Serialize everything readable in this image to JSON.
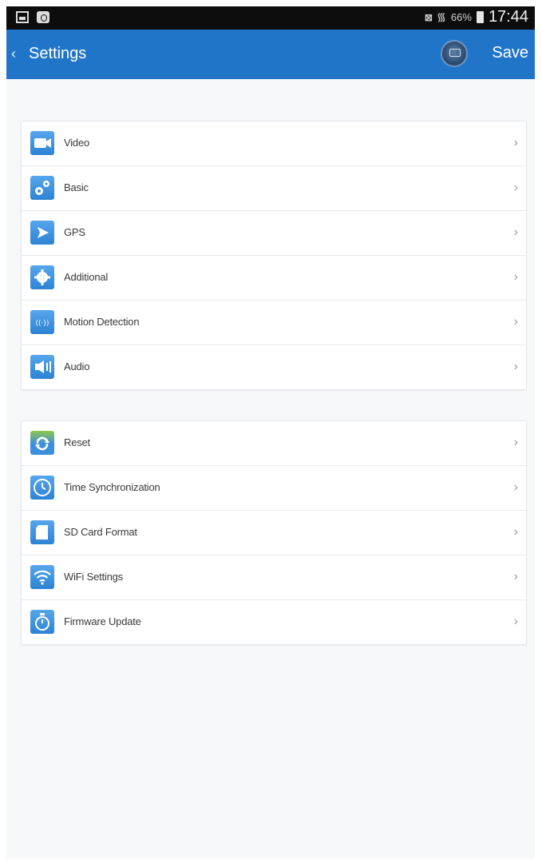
{
  "status_bar": {
    "battery_pct": "66%",
    "time": "17:44"
  },
  "app_bar": {
    "title": "Settings",
    "save_label": "Save"
  },
  "groups": [
    {
      "items": [
        {
          "label": "Video",
          "icon": "video-camera-icon"
        },
        {
          "label": "Basic",
          "icon": "gears-icon"
        },
        {
          "label": "GPS",
          "icon": "gps-icon"
        },
        {
          "label": "Additional",
          "icon": "gear-icon"
        },
        {
          "label": "Motion Detection",
          "icon": "motion-detection-icon"
        },
        {
          "label": "Audio",
          "icon": "speaker-icon"
        }
      ]
    },
    {
      "items": [
        {
          "label": "Reset",
          "icon": "reset-icon"
        },
        {
          "label": "Time Synchronization",
          "icon": "clock-icon"
        },
        {
          "label": "SD Card Format",
          "icon": "sd-card-icon"
        },
        {
          "label": "WiFi Settings",
          "icon": "wifi-icon"
        },
        {
          "label": "Firmware Update",
          "icon": "firmware-update-icon"
        }
      ]
    }
  ],
  "colors": {
    "app_bar": "#2175c9",
    "icon_tile": "#3b8fdc"
  }
}
